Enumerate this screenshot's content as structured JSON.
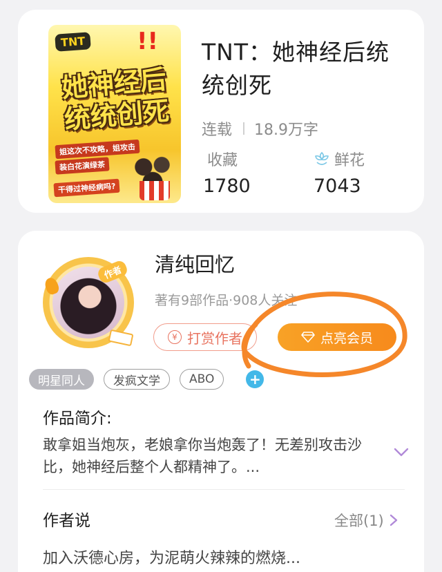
{
  "book": {
    "cover": {
      "logo_text": "TNT",
      "title_line1": "她神经后",
      "title_line2": "统统创死",
      "tag1": "姐这次不攻略，姐攻击",
      "tag2": "装白花演绿茶",
      "tag3": "干得过神经病吗?"
    },
    "title": "TNT：她神经后统统创死",
    "status": "连载",
    "word_count": "18.9万字",
    "collect_label": "收藏",
    "collect_value": "1780",
    "flower_label": "鲜花",
    "flower_value": "7043"
  },
  "author": {
    "badge": "作者",
    "name": "清纯回忆",
    "meta": "著有9部作品·908人关注",
    "reward_label": "打赏作者",
    "vip_label": "点亮会员"
  },
  "tags": [
    "明星同人",
    "发疯文学",
    "ABO"
  ],
  "intro": {
    "title": "作品简介:",
    "text": "敢拿姐当炮灰，老娘拿你当炮轰了！无差别攻击沙比，她神经后整个人都精神了。..."
  },
  "author_says": {
    "title": "作者说",
    "all_label": "全部(1)",
    "text": "加入沃德心房，为泥萌火辣辣的燃烧..."
  },
  "colors": {
    "accent_orange": "#f8a226",
    "reward_red": "#e8735f",
    "plus_blue": "#43b8e8",
    "expand_purple": "#b089d8"
  }
}
